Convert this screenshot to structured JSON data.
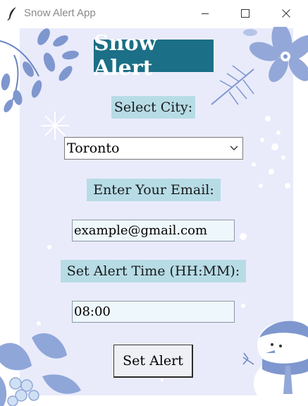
{
  "window": {
    "title": "Snow Alert App",
    "app_icon": "feather-icon",
    "controls": [
      "minimize-icon",
      "maximize-icon",
      "close-icon"
    ]
  },
  "form": {
    "heading": "Snow Alert",
    "city_label": "Select City:",
    "city_value": "Toronto",
    "email_label": "Enter Your Email:",
    "email_value": "example@gmail.com",
    "time_label": "Set Alert Time (HH:MM):",
    "time_value": "08:00",
    "submit_label": "Set Alert"
  },
  "colors": {
    "heading_bg": "#1b6f87",
    "label_bg": "#b7dce6",
    "panel_bg": "#e9ebfb",
    "input_bg": "#eef7fb"
  },
  "decorations": [
    "leaf-branch-icon",
    "poinsettia-icon",
    "snowflake-icon",
    "holly-icon",
    "snowman-icon"
  ]
}
